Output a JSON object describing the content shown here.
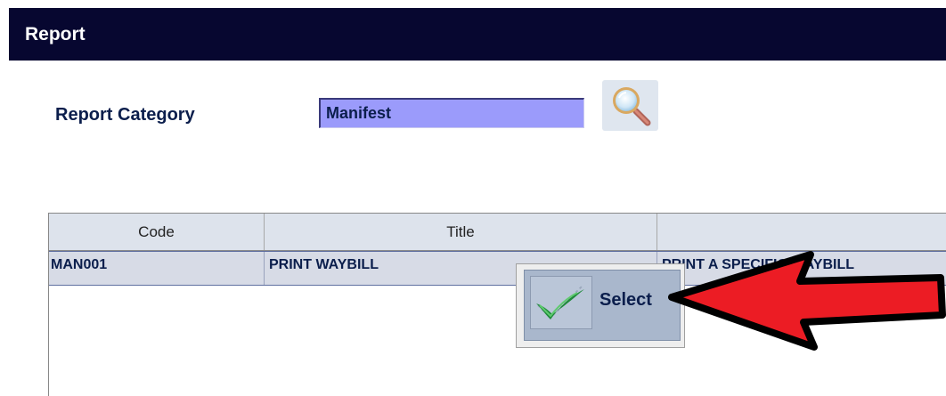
{
  "header": {
    "title": "Report"
  },
  "form": {
    "category_label": "Report Category",
    "category_value": "Manifest",
    "search_icon": "magnifier-icon"
  },
  "grid": {
    "columns": [
      "Code",
      "Title",
      ""
    ],
    "rows": [
      {
        "code": "MAN001",
        "title": "PRINT WAYBILL",
        "description": "PRINT A SPECIFIC WAYBILL"
      }
    ]
  },
  "context_menu": {
    "select_label": "Select",
    "select_icon": "checkmark-icon"
  },
  "annotation": {
    "arrow_color": "#ec1c24"
  }
}
